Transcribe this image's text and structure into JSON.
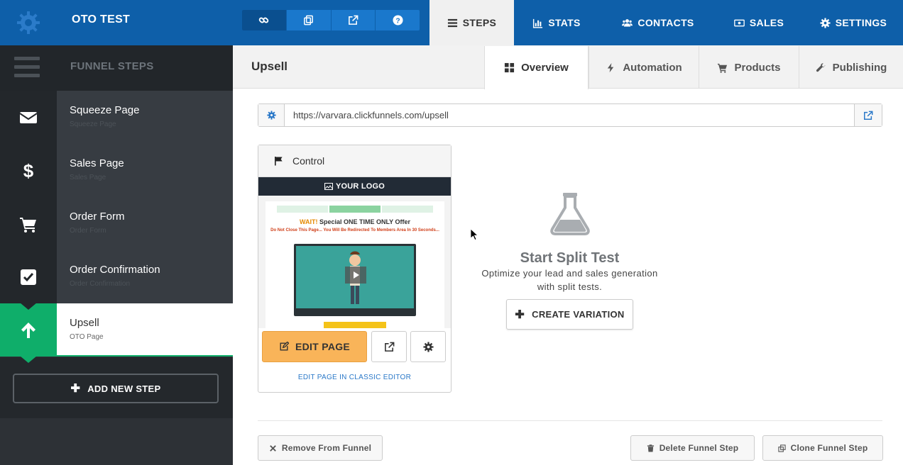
{
  "app": {
    "title": "OTO TEST"
  },
  "colors": {
    "brand_blue": "#0e5fa9",
    "active_green": "#0fae6a",
    "edit_orange": "#f9b459",
    "sidebar_dark": "#2d3136"
  },
  "toolbar": {
    "icons": [
      "link-icon",
      "copy-icon",
      "external-link-icon",
      "help-icon"
    ]
  },
  "nav": {
    "steps": "STEPS",
    "stats": "STATS",
    "contacts": "CONTACTS",
    "sales": "SALES",
    "settings": "SETTINGS"
  },
  "sidebar": {
    "title": "FUNNEL STEPS",
    "steps": [
      {
        "name": "Squeeze Page",
        "sub": "Squeeze Page",
        "icon": "envelope-icon"
      },
      {
        "name": "Sales Page",
        "sub": "Sales Page",
        "icon": "dollar-icon"
      },
      {
        "name": "Order Form",
        "sub": "Order Form",
        "icon": "cart-icon"
      },
      {
        "name": "Order Confirmation",
        "sub": "Order Confirmation",
        "icon": "checkbox-icon"
      },
      {
        "name": "Upsell",
        "sub": "OTO Page",
        "icon": "arrow-up-icon"
      }
    ],
    "add_step": "ADD NEW STEP"
  },
  "page": {
    "title": "Upsell",
    "tabs": {
      "overview": "Overview",
      "automation": "Automation",
      "products": "Products",
      "publishing": "Publishing"
    },
    "url": "https://varvara.clickfunnels.com/upsell"
  },
  "variant": {
    "label": "Control",
    "preview": {
      "logo": "YOUR LOGO",
      "wait": "WAIT!",
      "headline": " Special ONE TIME ONLY Offer",
      "subline": "Do Not Close This Page... You Will Be Redirected To Members Area In 30 Seconds..."
    },
    "edit_button": "EDIT PAGE",
    "classic_link": "EDIT PAGE IN CLASSIC EDITOR"
  },
  "split_test": {
    "title": "Start Split Test",
    "description": "Optimize your lead and sales generation with split tests.",
    "button": "CREATE VARIATION"
  },
  "footer": {
    "remove": "Remove From Funnel",
    "delete": "Delete Funnel Step",
    "clone": "Clone Funnel Step"
  }
}
